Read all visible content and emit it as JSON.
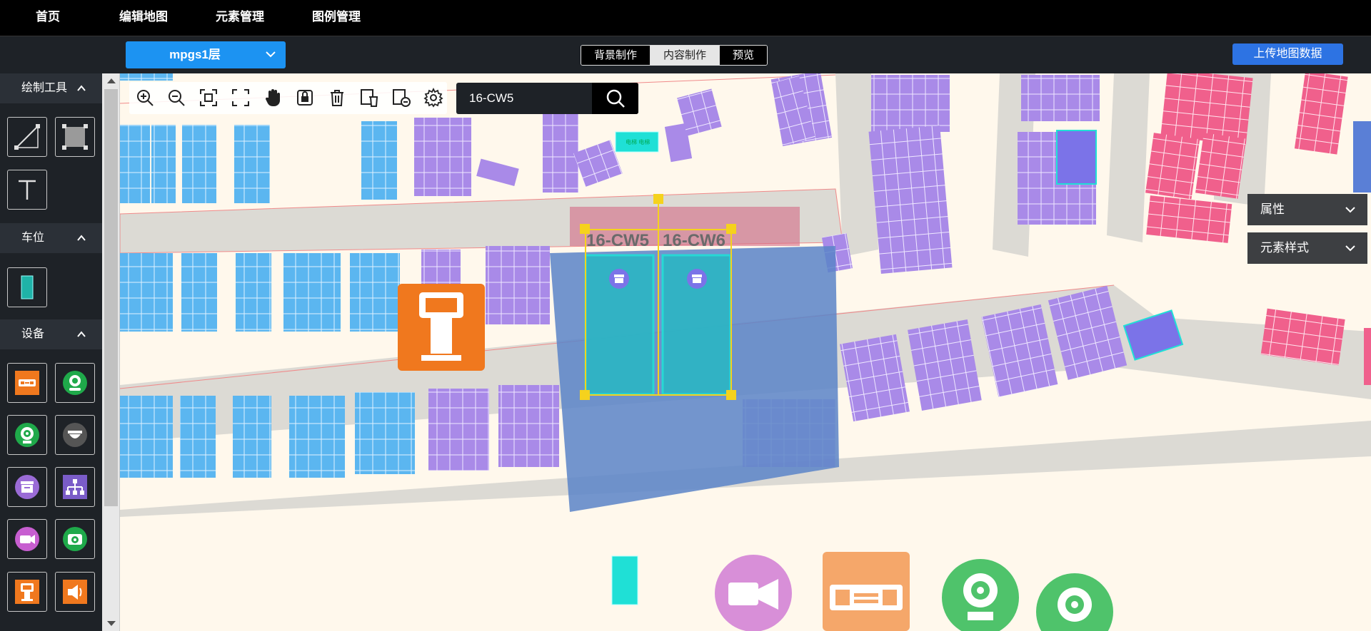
{
  "nav": {
    "items": [
      "首页",
      "编辑地图",
      "元素管理",
      "图例管理"
    ]
  },
  "floor_select": {
    "value": "mpgs1层"
  },
  "mode_tabs": [
    "背景制作",
    "内容制作",
    "预览"
  ],
  "active_mode": "内容制作",
  "upload_button": "上传地图数据",
  "sidebar": {
    "sections": [
      {
        "title": "绘制工具"
      },
      {
        "title": "车位"
      },
      {
        "title": "设备"
      }
    ]
  },
  "search": {
    "value": "16-CW5"
  },
  "selected": {
    "spaces": [
      "16-CW5",
      "16-CW6"
    ]
  },
  "right_panels": {
    "properties": "属性",
    "element_style": "元素样式"
  },
  "colors": {
    "accent_blue": "#1c93f2",
    "upload_blue": "#2d73e3",
    "map_bg": "#fff8ec",
    "road": "#dcdad4",
    "space_blue": "#5bb6f0",
    "space_purple": "#a98ae8",
    "space_pink": "#f0608c",
    "space_cyan": "#1fe0d6",
    "device_orange": "#f0781e",
    "device_green": "#1fa94a",
    "device_purple": "#9a6bd6",
    "selection_yellow": "#f5d21d"
  },
  "icons": {
    "draw_tools": [
      "line-icon",
      "rectangle-icon",
      "text-icon"
    ],
    "parking": [
      "parking-space-icon"
    ],
    "devices": [
      "guidance-screen-icon",
      "camera-green-icon",
      "camera-green-2-icon",
      "dome-camera-icon",
      "sign-purple-icon",
      "network-icon",
      "video-camera-icon",
      "camera-box-icon",
      "kiosk-icon",
      "speaker-icon"
    ],
    "map_toolbar": [
      "zoom-in-icon",
      "zoom-out-icon",
      "fit-icon",
      "fullscreen-icon",
      "pan-hand-icon",
      "lock-icon",
      "delete-icon",
      "delete-multi-icon",
      "delete-select-icon",
      "settings-icon"
    ]
  }
}
